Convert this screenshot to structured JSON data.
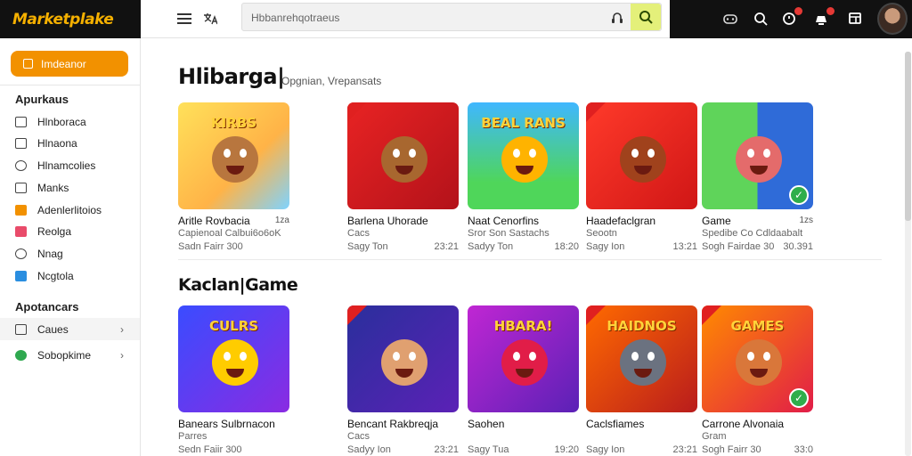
{
  "app": {
    "logo": "Marketplake"
  },
  "search": {
    "placeholder": "Hbbanrehqotraeus"
  },
  "icons": {
    "menu": "hamburger-icon",
    "translate": "translate-icon",
    "mic": "microphone-icon",
    "search": "search-icon",
    "controller": "gamepad-icon",
    "notify": "notification-icon",
    "cart": "cart-icon",
    "window": "window-icon"
  },
  "colors": {
    "accent": "#f29100",
    "search_go": "#e4f07a",
    "check": "#2fae4b",
    "badge": "#e53935"
  },
  "sidebar": {
    "primary_button": "Imdeanor",
    "section1": "Apurkaus",
    "items1": [
      {
        "label": "Hlnboraca",
        "icon": "home-icon"
      },
      {
        "label": "Hlnaona",
        "icon": "library-icon"
      },
      {
        "label": "Hlnamcolies",
        "icon": "clock-icon"
      },
      {
        "label": "Manks",
        "icon": "bookmark-icon"
      },
      {
        "label": "Adenlerlitoios",
        "icon": "apps-icon"
      },
      {
        "label": "Reolga",
        "icon": "tag-icon"
      },
      {
        "label": "Nnag",
        "icon": "globe-icon"
      },
      {
        "label": "Ncgtola",
        "icon": "download-icon"
      }
    ],
    "section2": "Apotancars",
    "items2": [
      {
        "label": "Caues",
        "icon": "grid-icon",
        "selected": true
      },
      {
        "label": "Sobopkime",
        "icon": "circle-icon"
      }
    ]
  },
  "sections": [
    {
      "title": "Hlibarga|",
      "subtitle": "Opgnian, Vrepansats",
      "cards": [
        {
          "title": "Aritle Rovbacia",
          "extra": "1za",
          "sub": "Capienoal Calbui6o6oK",
          "meta": "Sadn Fairr 300",
          "num": "",
          "ribbon": false,
          "check": false,
          "art": "KIRBS",
          "bg": "linear-gradient(135deg,#ffe15a,#ffb347 60%,#7fd3ff)",
          "face": "#b8763e"
        },
        {
          "title": "Barlena Uhorade",
          "extra": "",
          "sub": "Cacs",
          "meta": "Sagy Ton",
          "num": "23:21",
          "ribbon": true,
          "check": false,
          "art": "",
          "bg": "linear-gradient(135deg,#e82323,#b3121a)",
          "face": "#a8672f"
        },
        {
          "title": "Naat Cenorfins",
          "extra": "",
          "sub": "Sror Son Sastachs",
          "meta": "Sadyy Ton",
          "num": "18:20",
          "ribbon": false,
          "check": false,
          "art": "BEAL RANS",
          "bg": "linear-gradient(180deg,#3fb7ff,#4fd65a 75%)",
          "face": "#ffb300"
        },
        {
          "title": "Haadefaclgran",
          "extra": "",
          "sub": "Seootn",
          "meta": "Sagy Ion",
          "num": "13:21",
          "ribbon": true,
          "check": false,
          "art": "",
          "bg": "linear-gradient(135deg,#ff3a2a,#d01616)",
          "face": "#a0421c"
        },
        {
          "title": "Game",
          "extra": "1zs",
          "sub": "Spedibe Co Cdldaabalt",
          "meta": "Sogh Fairdae 30",
          "num": "30.391",
          "ribbon": false,
          "check": true,
          "art": "",
          "bg": "linear-gradient(90deg,#5fd45a 0 50%,#2f6bd8 50%)",
          "face": "#e46b6b"
        }
      ]
    },
    {
      "title": "Kaclan|Game",
      "subtitle": "",
      "cards": [
        {
          "title": "Banears Sulbrnacon",
          "extra": "",
          "sub": "Parres",
          "meta": "Sedn Faiir 300",
          "num": "",
          "ribbon": false,
          "check": false,
          "art": "CULRS",
          "bg": "linear-gradient(135deg,#3a4cff,#8a2be2)",
          "face": "#ffcc00"
        },
        {
          "title": "Bencant Rakbreqja",
          "extra": "",
          "sub": "Cacs",
          "meta": "Sadyy Ion",
          "num": "23:21",
          "ribbon": true,
          "check": false,
          "art": "",
          "bg": "linear-gradient(135deg,#2a2f9c,#5b21b6)",
          "face": "#e0a070"
        },
        {
          "title": "Saohen",
          "extra": "",
          "sub": "",
          "meta": "Sagy Tua",
          "num": "19:20",
          "ribbon": false,
          "check": false,
          "art": "HBARA!",
          "bg": "linear-gradient(135deg,#c026d3,#5b21b6)",
          "face": "#e11d48"
        },
        {
          "title": "Caclsfiames",
          "extra": "",
          "sub": "",
          "meta": "Sagy Ion",
          "num": "23:21",
          "ribbon": true,
          "check": false,
          "art": "HAIDNOS",
          "bg": "linear-gradient(135deg,#ff6a00,#b91c1c)",
          "face": "#6b7280"
        },
        {
          "title": "Carrone Alvonaia",
          "extra": "",
          "sub": "Gram",
          "meta": "Sogh Fairr 30",
          "num": "33:0",
          "ribbon": true,
          "check": true,
          "art": "GAMES",
          "bg": "linear-gradient(135deg,#ff8a00,#e11d48)",
          "face": "#d9773a"
        }
      ]
    }
  ]
}
